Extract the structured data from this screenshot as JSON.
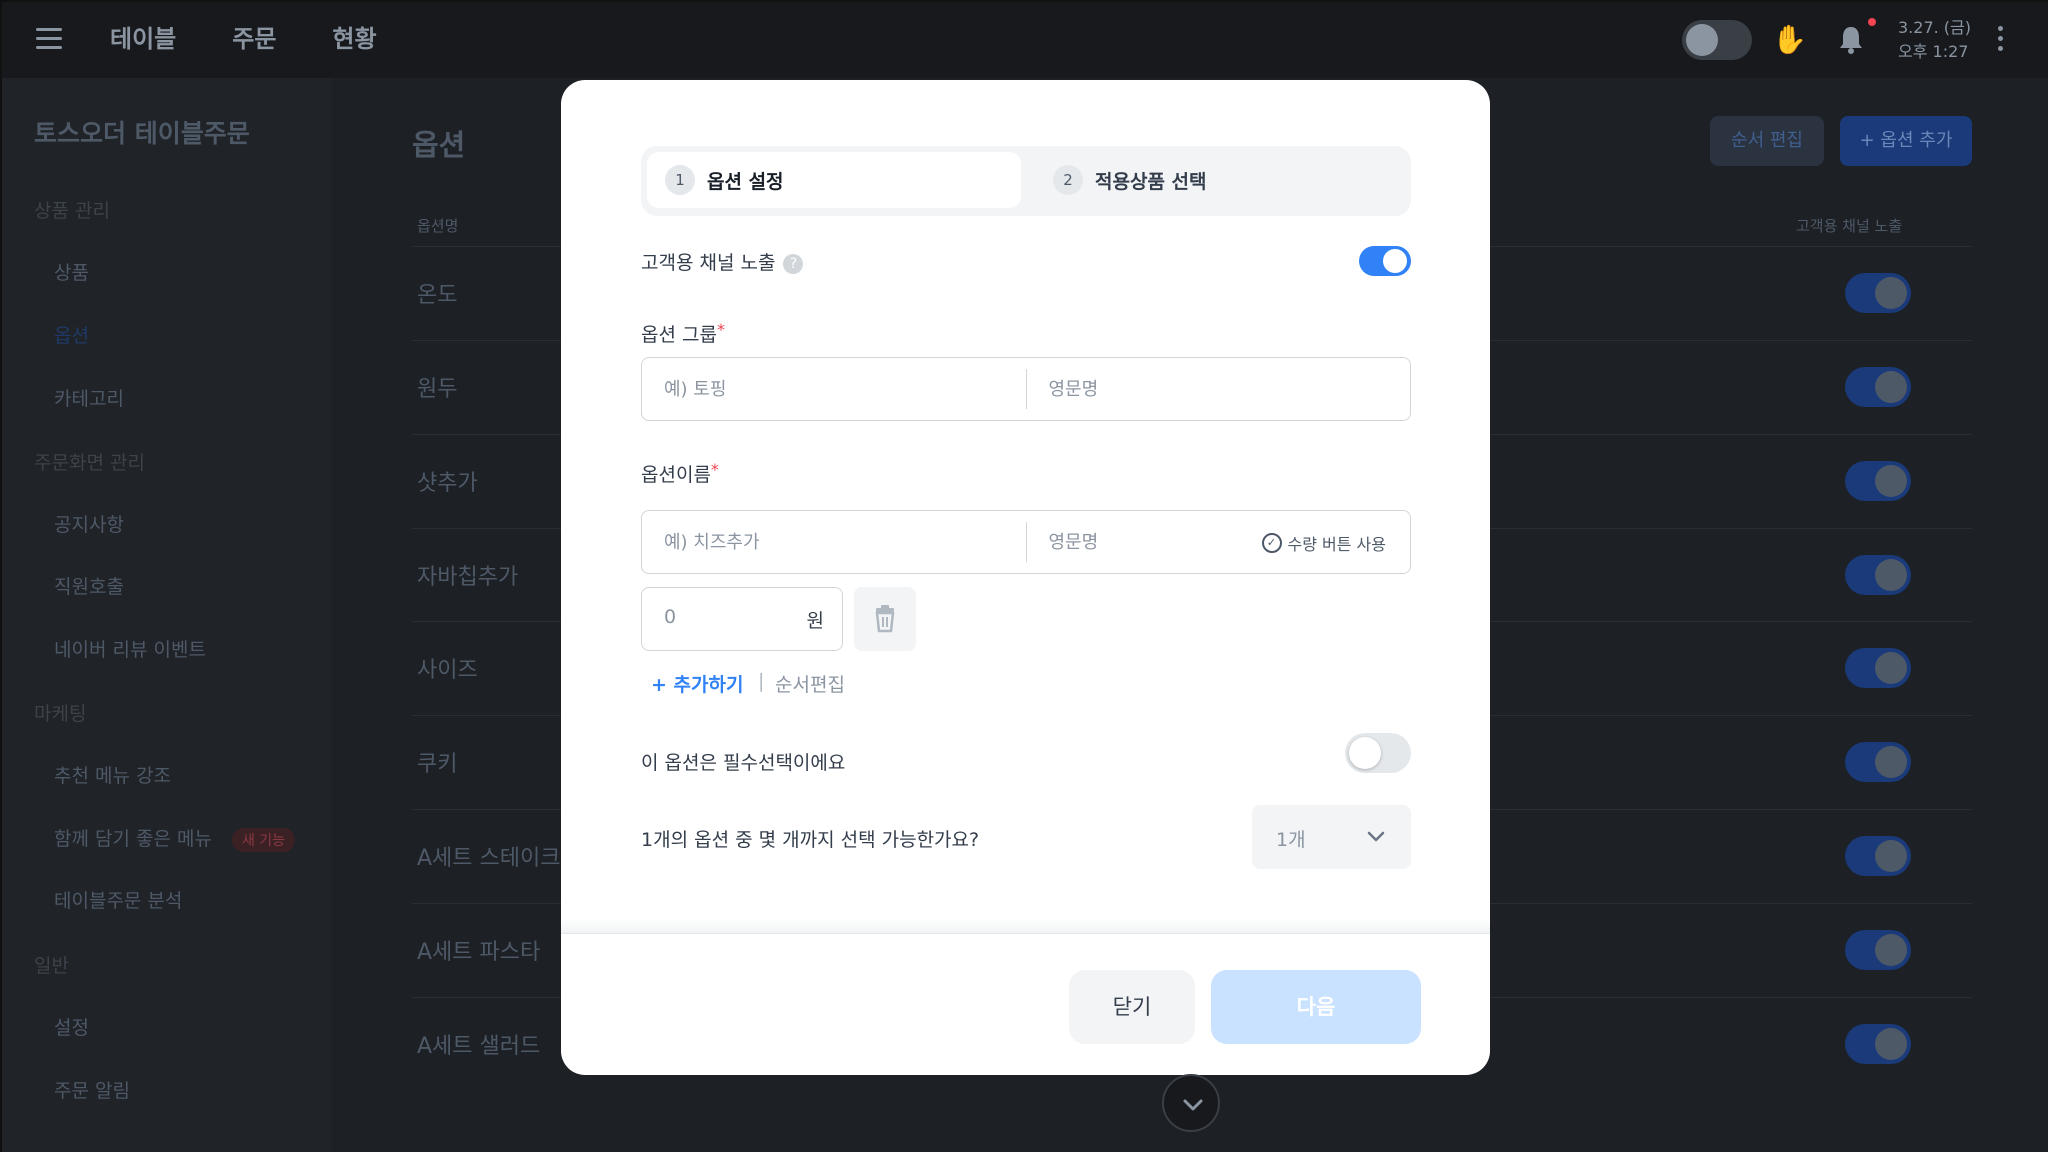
{
  "topbar": {
    "nav": [
      "테이블",
      "주문",
      "현황"
    ],
    "date": "3.27. (금)",
    "time": "오후 1:27"
  },
  "sidebar": {
    "store_name": "토스오더 테이블주문",
    "sections": [
      {
        "title": "상품 관리",
        "items": [
          "상품",
          "옵션",
          "카테고리"
        ]
      },
      {
        "title": "주문화면 관리",
        "items": [
          "공지사항",
          "직원호출",
          "네이버 리뷰 이벤트"
        ]
      },
      {
        "title": "마케팅",
        "items": [
          "추천 메뉴 강조",
          "함께 담기 좋은 메뉴",
          "테이블주문 분석"
        ]
      },
      {
        "title": "일반",
        "items": [
          "설정",
          "주문 알림"
        ]
      }
    ],
    "active_item": "옵션",
    "new_badge": "새 기능"
  },
  "main": {
    "title": "옵션",
    "order_edit_button": "순서 편집",
    "add_option_button": "+ 옵션 추가",
    "col_name": "옵션명",
    "col_expose": "고객용 채널 노출",
    "rows": [
      "온도",
      "원두",
      "샷추가",
      "자바칩추가",
      "사이즈",
      "쿠키",
      "A세트 스테이크",
      "A세트 파스타",
      "A세트 샐러드"
    ]
  },
  "modal": {
    "steps": [
      {
        "num": "1",
        "label": "옵션 설정"
      },
      {
        "num": "2",
        "label": "적용상품 선택"
      }
    ],
    "expose_label": "고객용 채널 노출",
    "expose_on": true,
    "group_label": "옵션 그룹",
    "group_placeholder": "예) 토핑",
    "group_en_placeholder": "영문명",
    "name_label": "옵션이름",
    "name_placeholder": "예) 치즈추가",
    "name_en_placeholder": "영문명",
    "qty_button_label": "수량 버튼 사용",
    "price_placeholder": "0",
    "price_unit": "원",
    "add_link": "+ 추가하기",
    "separator": "|",
    "order_edit_link": "순서편집",
    "required_label": "이 옵션은 필수선택이에요",
    "required_on": false,
    "max_select_label": "1개의 옵션 중 몇 개까지 선택 가능한가요?",
    "max_select_value": "1개",
    "close_button": "닫기",
    "next_button": "다음"
  },
  "colors": {
    "accent": "#3182f6",
    "next_disabled": "#c9e2ff",
    "required_mark": "#f04452"
  }
}
